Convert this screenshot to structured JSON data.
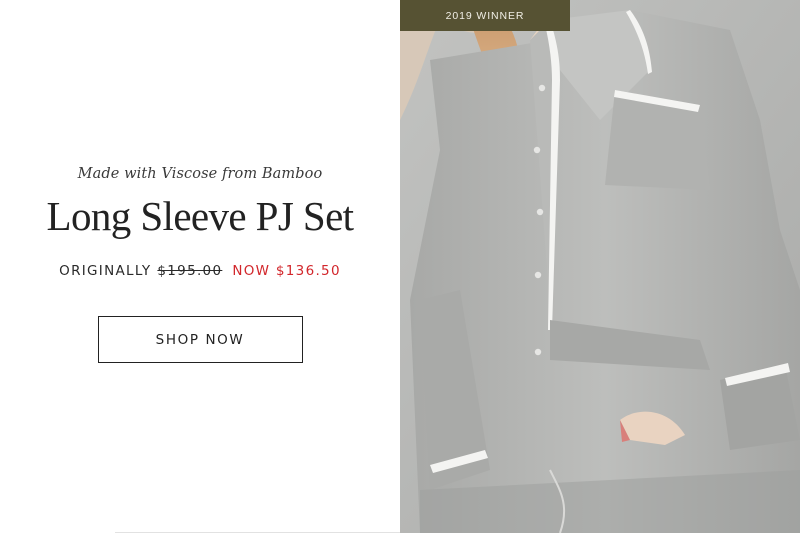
{
  "hero": {
    "tagline": "Made with Viscose from Bamboo",
    "title": "Long Sleeve PJ Set",
    "price": {
      "original_label": "ORIGINALLY",
      "original_price": "$195.00",
      "now_price": "NOW $136.50"
    },
    "cta_label": "SHOP NOW"
  },
  "photo": {
    "badge": "2019 WINNER"
  },
  "colors": {
    "accent_sale": "#d2262b",
    "badge_bg": "#565233",
    "fabric": "#b3b4b1"
  }
}
